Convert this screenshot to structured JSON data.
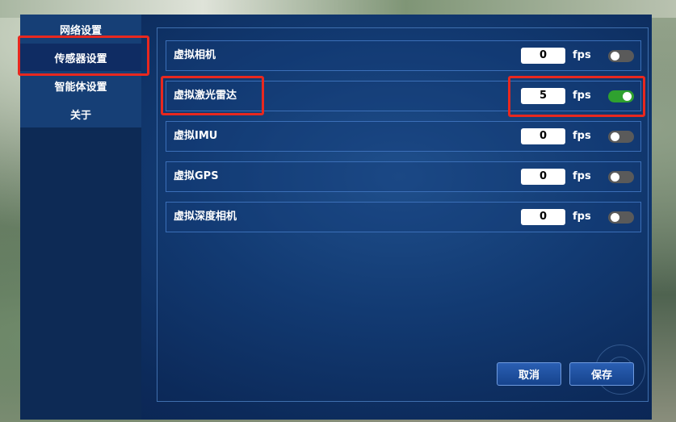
{
  "sidebar": {
    "items": [
      {
        "label": "网络设置",
        "active": false
      },
      {
        "label": "传感器设置",
        "active": true
      },
      {
        "label": "智能体设置",
        "active": false
      },
      {
        "label": "关于",
        "active": false
      }
    ]
  },
  "sensors": [
    {
      "label": "虚拟相机",
      "fps": "0",
      "unit": "fps",
      "enabled": false
    },
    {
      "label": "虚拟激光雷达",
      "fps": "5",
      "unit": "fps",
      "enabled": true
    },
    {
      "label": "虚拟IMU",
      "fps": "0",
      "unit": "fps",
      "enabled": false
    },
    {
      "label": "虚拟GPS",
      "fps": "0",
      "unit": "fps",
      "enabled": false
    },
    {
      "label": "虚拟深度相机",
      "fps": "0",
      "unit": "fps",
      "enabled": false
    }
  ],
  "footer": {
    "cancel_label": "取消",
    "save_label": "保存"
  },
  "colors": {
    "highlight": "#e8281f",
    "toggle_on": "#2fa12f",
    "toggle_off": "#5a5a5a"
  }
}
